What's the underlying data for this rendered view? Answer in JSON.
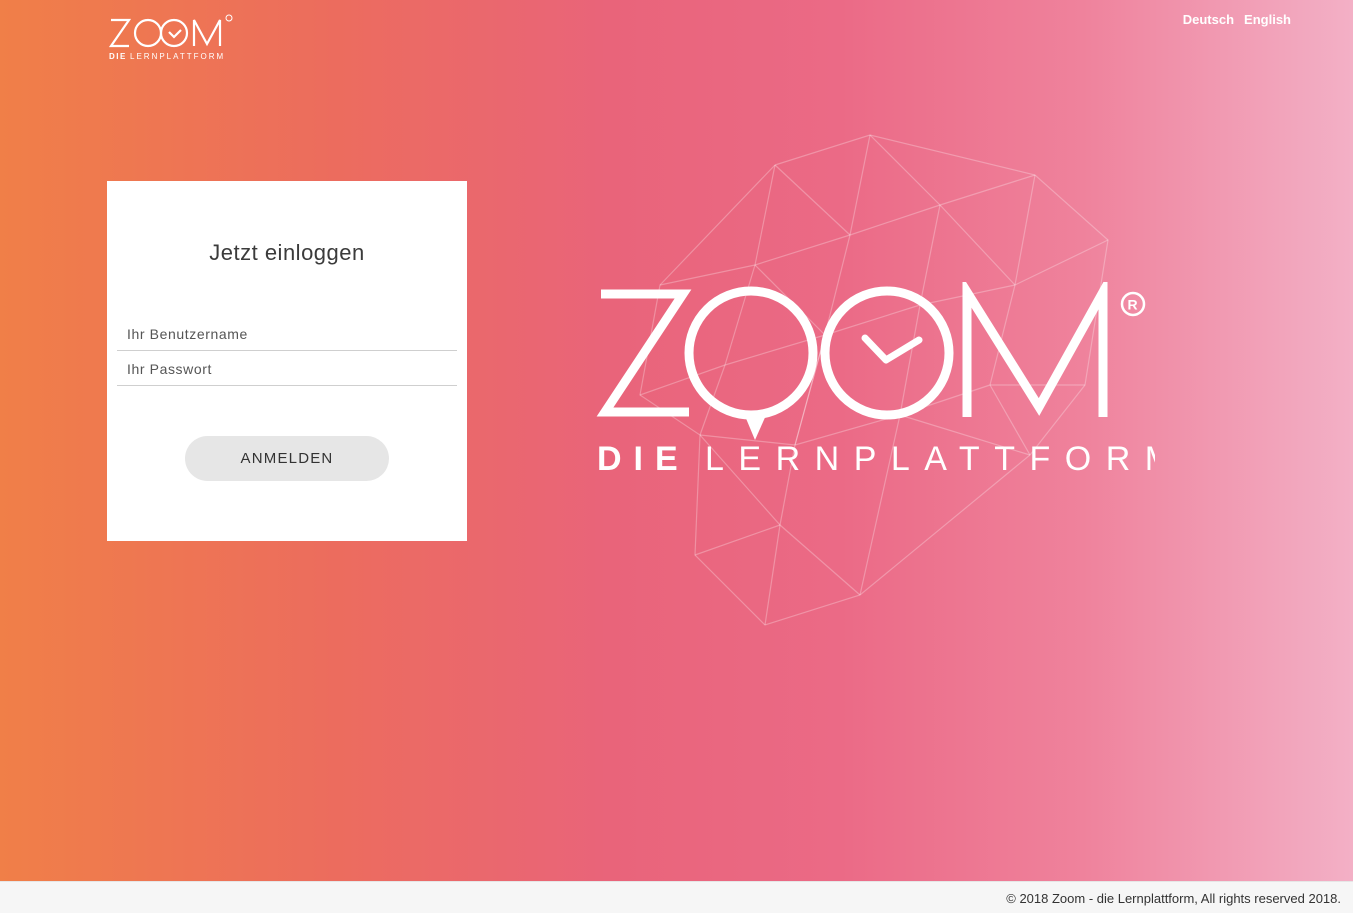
{
  "brand": {
    "name": "ZOOM",
    "tagline_bold": "DIE",
    "tagline_light": "LERNPLATTFORM",
    "registered_mark": "®"
  },
  "language": {
    "options": [
      "Deutsch",
      "English"
    ]
  },
  "login": {
    "title": "Jetzt einloggen",
    "username_placeholder": "Ihr Benutzername",
    "username_value": "",
    "password_placeholder": "Ihr Passwort",
    "password_value": "",
    "submit_label": "ANMELDEN"
  },
  "footer": {
    "copyright": "© 2018 Zoom - die Lernplattform, All rights reserved 2018."
  },
  "colors": {
    "gradient": [
      "#f07f48",
      "#ec6c5e",
      "#e9647a",
      "#eb6a86",
      "#ef829c",
      "#f3b0c6"
    ],
    "card": "#ffffff",
    "button": "#e6e6e6"
  },
  "icons": [
    "zoom-logo-icon",
    "clock-hands-icon",
    "wireframe-decoration-icon"
  ]
}
